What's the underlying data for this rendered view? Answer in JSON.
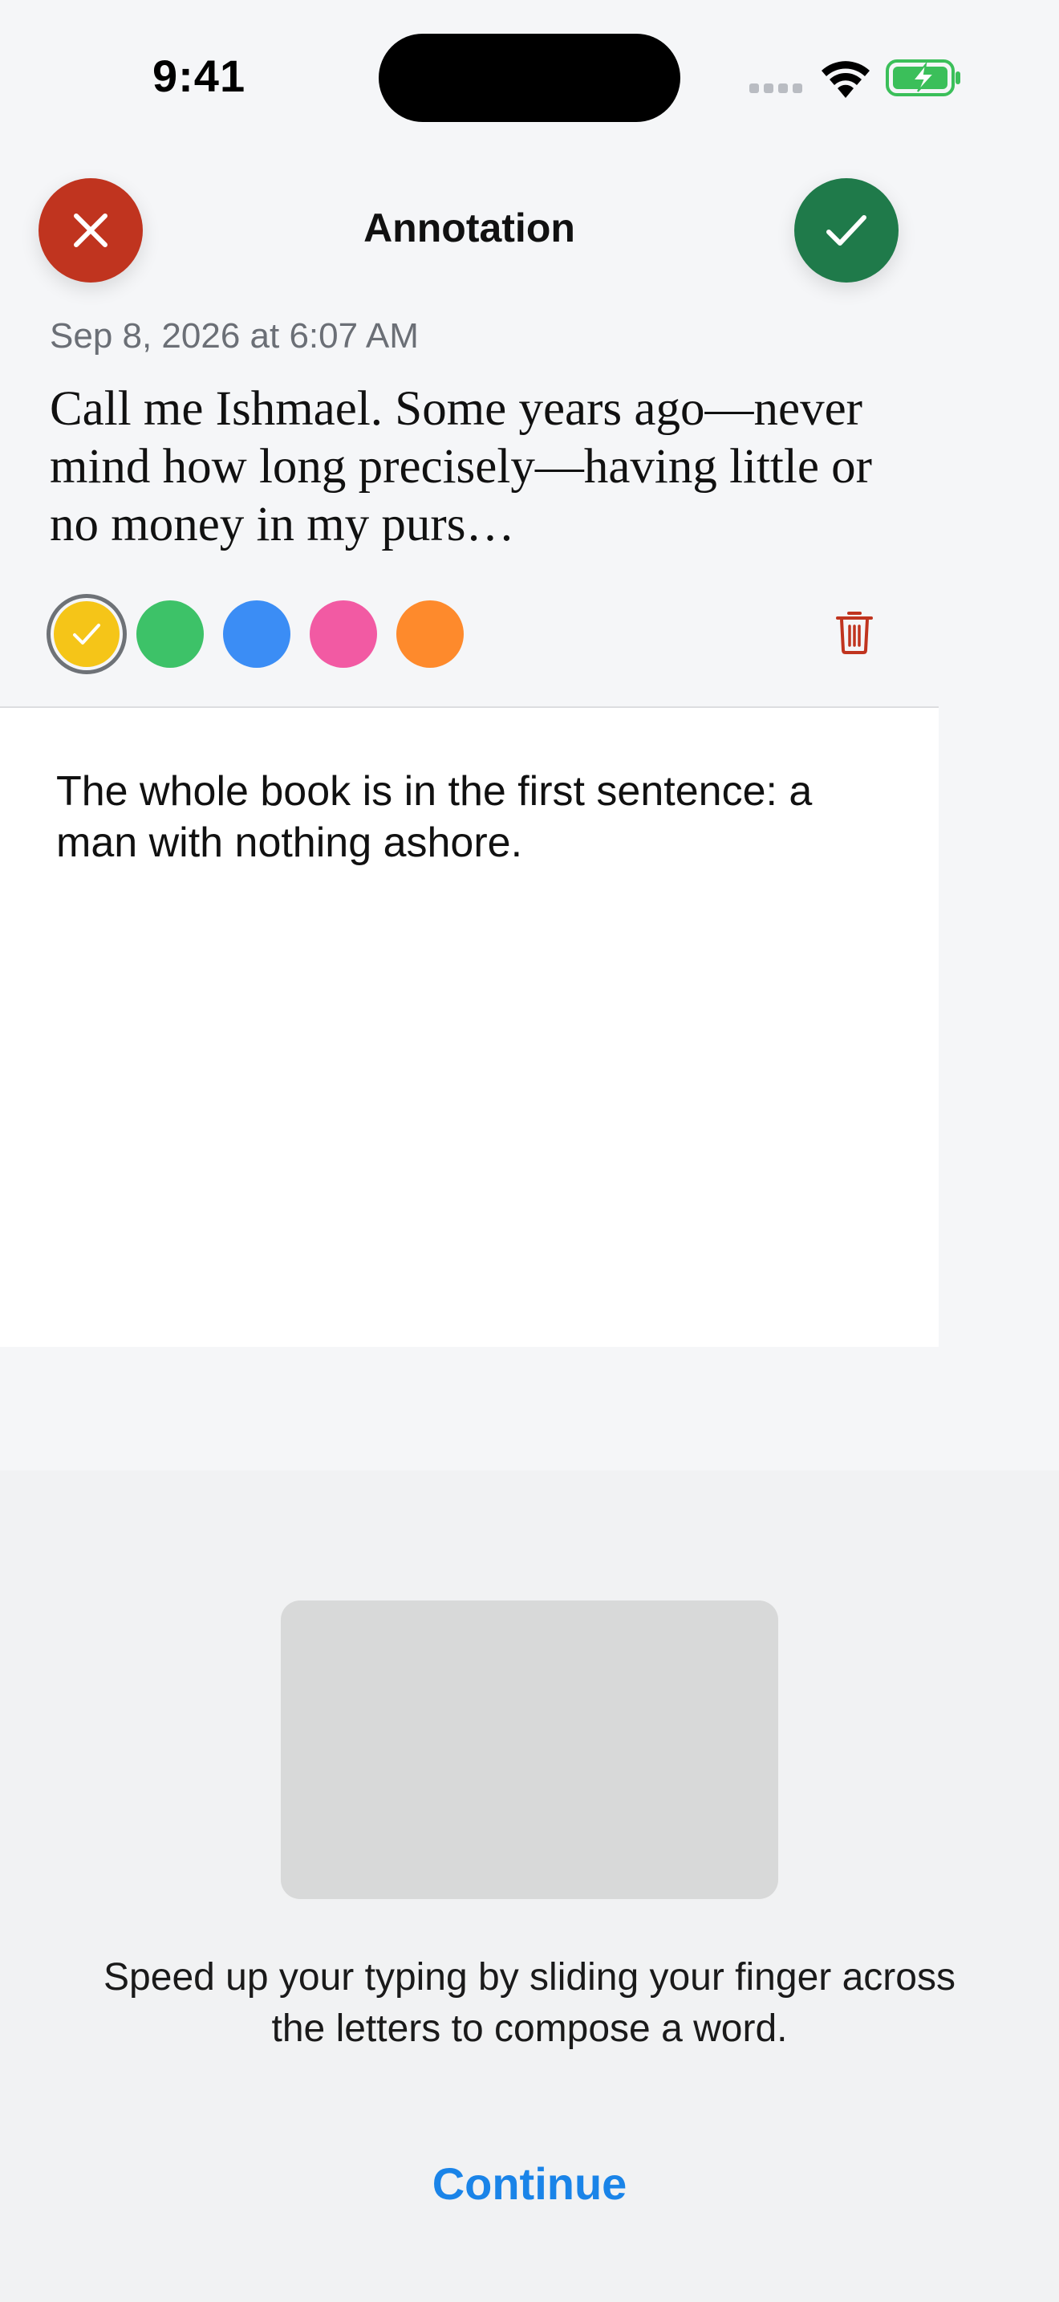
{
  "status_bar": {
    "time": "9:41"
  },
  "header": {
    "title": "Annotation",
    "cancel_icon": "close-icon",
    "confirm_icon": "checkmark-icon"
  },
  "annotation": {
    "timestamp": "Sep 8, 2026 at 6:07 AM",
    "quote": "Call me Ishmael. Some years ago—never mind how long precisely—having little or no money in my purs…",
    "note": "The whole book is in the first sentence: a man with nothing ashore."
  },
  "highlight_colors": [
    {
      "name": "yellow",
      "hex": "#f5c518",
      "selected": true
    },
    {
      "name": "green",
      "hex": "#3dc268",
      "selected": false
    },
    {
      "name": "blue",
      "hex": "#3b8df5",
      "selected": false
    },
    {
      "name": "pink",
      "hex": "#f25aa3",
      "selected": false
    },
    {
      "name": "orange",
      "hex": "#fe8a2c",
      "selected": false
    }
  ],
  "keyboard_tip": {
    "message": "Speed up your typing by sliding your finger across the letters to compose a word.",
    "continue_label": "Continue"
  },
  "colors": {
    "cancel": "#c0341f",
    "confirm": "#1f7a4a",
    "accent": "#1a84e8",
    "delete": "#c0341f"
  }
}
